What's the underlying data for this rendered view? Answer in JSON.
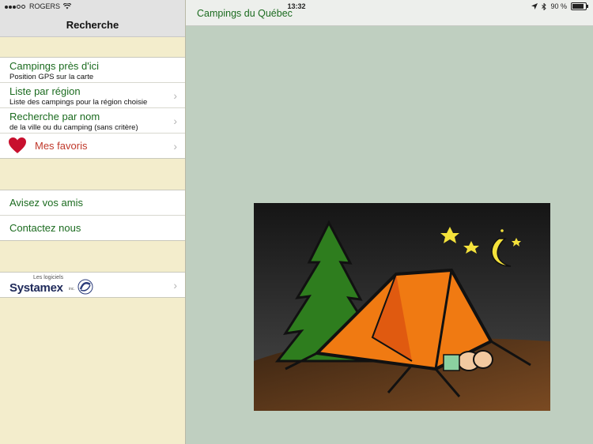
{
  "status": {
    "carrier": "ROGERS",
    "time": "13:32",
    "battery": "90 %"
  },
  "sidebar": {
    "title": "Recherche",
    "group1": [
      {
        "title": "Campings près d'ici",
        "subtitle": "Position GPS sur la carte"
      },
      {
        "title": "Liste par région",
        "subtitle": "Liste des campings pour la région choisie"
      },
      {
        "title": "Recherche par nom",
        "subtitle": "de la ville ou du camping (sans critère)"
      },
      {
        "title": "Mes favoris"
      }
    ],
    "group2": [
      {
        "title": "Avisez vos amis"
      },
      {
        "title": "Contactez nous"
      }
    ],
    "logo": {
      "small": "Les logiciels",
      "big": "Systamex",
      "inc": "inc."
    }
  },
  "content": {
    "title": "Campings du Québec"
  },
  "colors": {
    "accent_green": "#1b6b1f",
    "favorite_red": "#c0392b",
    "sidebar_bg": "#f3edcc",
    "content_bg": "#bfcfc0"
  }
}
